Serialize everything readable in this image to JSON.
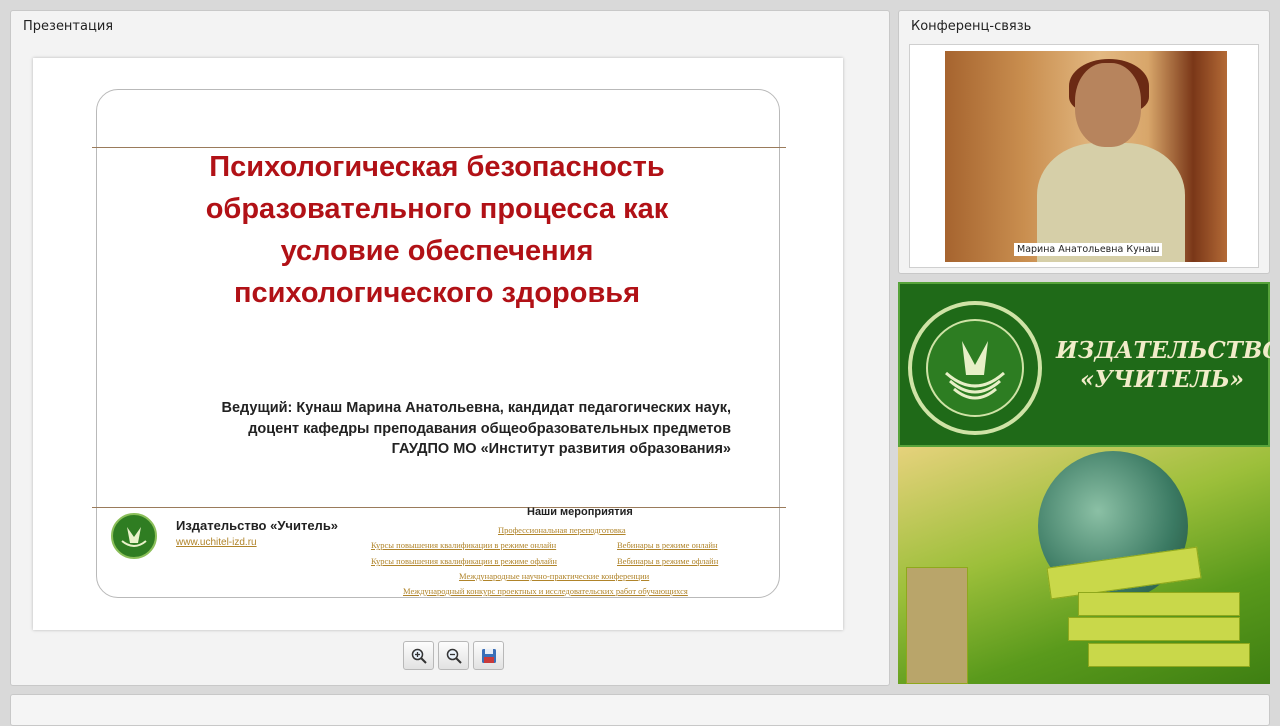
{
  "presentation": {
    "panel_title": "Презентация",
    "slide": {
      "title_lines": [
        "Психологическая безопасность",
        "образовательного процесса как",
        "условие обеспечения",
        "психологического здоровья"
      ],
      "presenter_lines": [
        "Ведущий: Кунаш Марина Анатольевна, кандидат педагогических наук,",
        "доцент кафедры преподавания общеобразовательных предметов",
        "ГАУДПО МО «Институт развития образования»"
      ],
      "publisher_name": "Издательство «Учитель»",
      "publisher_site": "www.uchitel-izd.ru",
      "events_title": "Наши мероприятия",
      "events": [
        "Профессиональная переподготовка",
        "Курсы повышения квалификации в режиме онлайн",
        "Вебинары в режиме онлайн",
        "Курсы повышения квалификации в режиме офлайн",
        "Вебинары в режиме офлайн",
        "Международные научно-практические конференции",
        "Международный конкурс проектных и исследовательских работ обучающихся"
      ]
    },
    "toolbar": {
      "zoom_in_icon": "zoom-in-icon",
      "zoom_out_icon": "zoom-out-icon",
      "save_icon": "floppy-disk-icon"
    }
  },
  "conference": {
    "panel_title": "Конференц-связь",
    "participant_name": "Марина Анатольевна Кунаш"
  },
  "banner": {
    "line1": "ИЗДАТЕЛЬСТВО",
    "line2": "«УЧИТЕЛЬ»"
  },
  "colors": {
    "slide_title": "#b11116",
    "accent_green": "#1f6a18",
    "link_gold": "#b0842a"
  }
}
